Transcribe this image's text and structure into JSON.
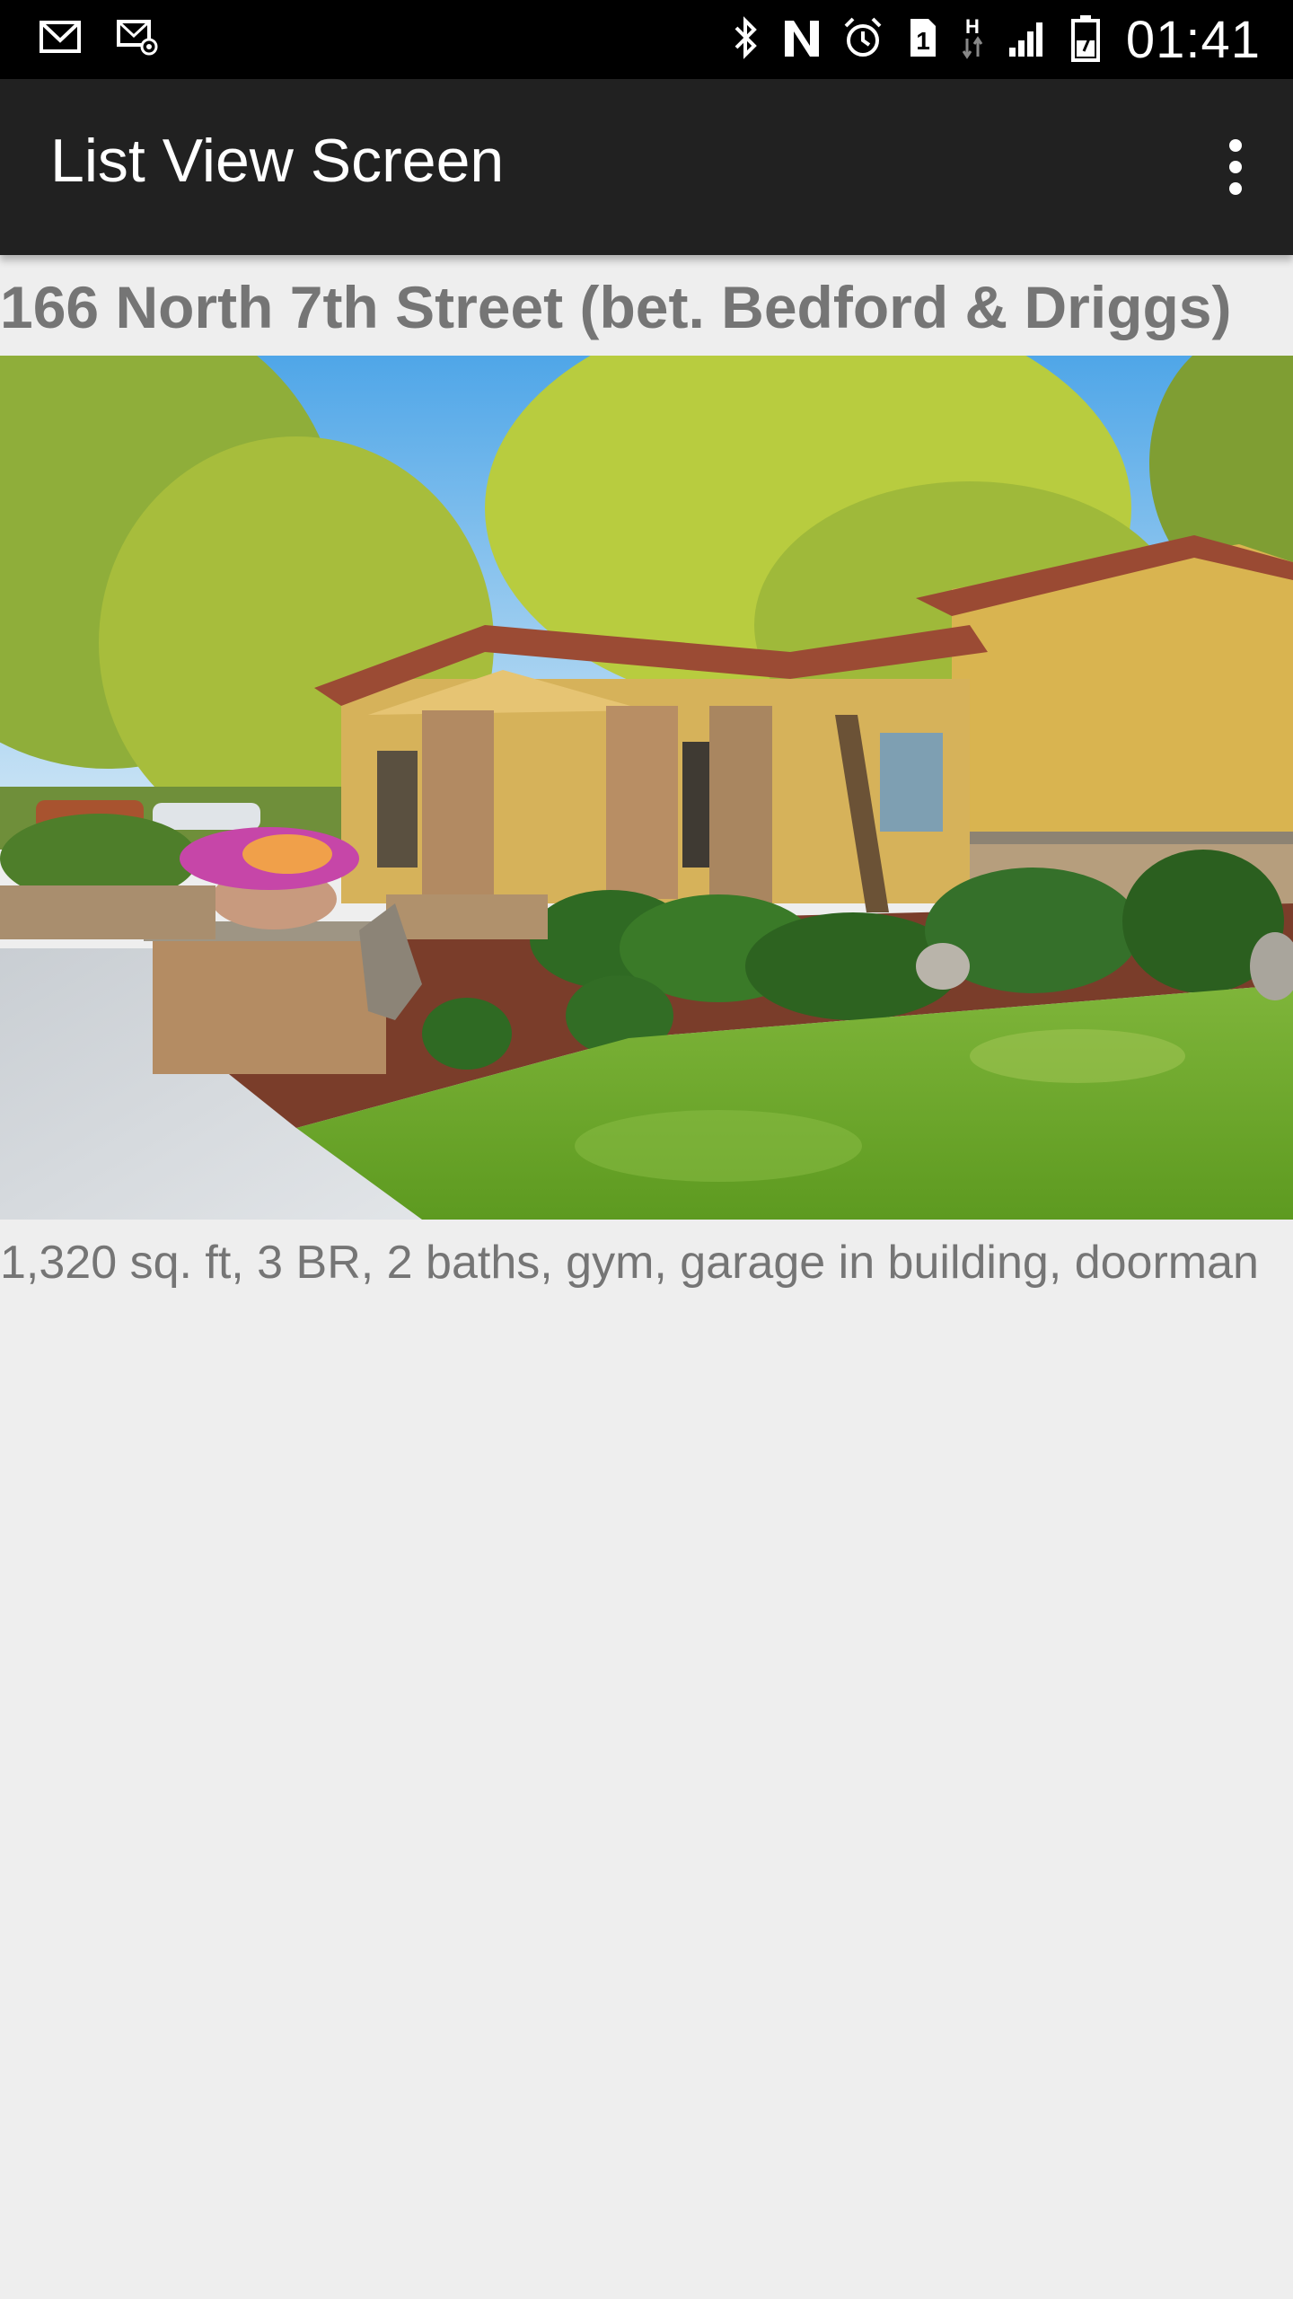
{
  "status_bar": {
    "time": "01:41",
    "left_icons": [
      "gmail-icon",
      "email-notification-icon"
    ],
    "right_icons": [
      "bluetooth-icon",
      "nfc-icon",
      "alarm-icon",
      "sim-1-icon",
      "h-data-icon",
      "signal-icon",
      "battery-icon"
    ]
  },
  "app_bar": {
    "title": "List View Screen",
    "overflow_icon": "more-vert-icon"
  },
  "listing": {
    "title": "166 North 7th Street (bet. Bedford & Driggs)",
    "description": "1,320 sq. ft, 3 BR, 2 baths, gym, garage in building, doorman",
    "photo_icon": "house-photo"
  }
}
